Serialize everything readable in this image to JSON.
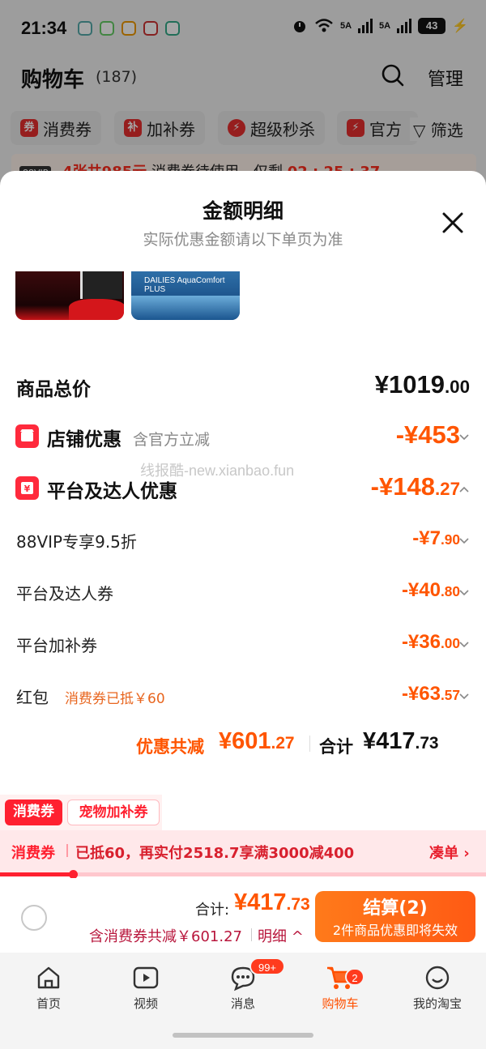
{
  "status_bar": {
    "time": "21:34",
    "signal1": "5A",
    "signal2": "5A",
    "battery": "43"
  },
  "cart": {
    "title": "购物车",
    "count": "(187)",
    "manage": "管理",
    "filters": [
      "消费券",
      "加补券",
      "超级秒杀",
      "官方"
    ],
    "filter_icons": [
      "券",
      "补",
      "⚡",
      "⚡"
    ],
    "filter_btn": "筛选",
    "banner": {
      "vip": "88VIP",
      "highlight": "4张共985元",
      "text": "消费券待使用，仅剩",
      "timer": "02 : 25 : 37"
    }
  },
  "sheet": {
    "title": "金额明细",
    "subtitle": "实际优惠金额请以下单页为准",
    "total_price": {
      "label": "商品总价",
      "int": "¥1019",
      "dec": ".00"
    },
    "store_discount": {
      "label": "店铺优惠",
      "note": "含官方立减",
      "int": "-¥453",
      "dec": ""
    },
    "platform_discount": {
      "label": "平台及达人优惠",
      "int": "-¥148",
      "dec": ".27"
    },
    "details": [
      {
        "label": "88VIP专享9.5折",
        "int": "-¥7",
        "dec": ".90",
        "note": ""
      },
      {
        "label": "平台及达人券",
        "int": "-¥40",
        "dec": ".80",
        "note": ""
      },
      {
        "label": "平台加补券",
        "int": "-¥36",
        "dec": ".00",
        "note": ""
      },
      {
        "label": "红包",
        "int": "-¥63",
        "dec": ".57",
        "note": "消费券已抵￥60"
      }
    ],
    "watermark": "线报酷-new.xianbao.fun",
    "summary": {
      "saved_label": "优惠共减",
      "saved_int": "¥601",
      "saved_dec": ".27",
      "total_label": "合计",
      "total_int": "¥417",
      "total_dec": ".73"
    }
  },
  "coupon": {
    "tags": [
      "消费券",
      "宠物加补券"
    ],
    "bar_label": "消费券",
    "bar_text": "已抵60，再实付2518.7享满3000减400",
    "bar_link": "凑单 ›",
    "progress": 0.15
  },
  "checkout": {
    "total_label": "合计:",
    "total_int": "¥417",
    "total_dec": ".73",
    "saved": "含消费券共减￥601.27",
    "detail_link": "明细 ^",
    "settle_label": "结算(2)",
    "settle_sub": "2件商品优惠即将失效"
  },
  "tabbar": [
    {
      "label": "首页",
      "icon": "home-icon"
    },
    {
      "label": "视频",
      "icon": "video-icon"
    },
    {
      "label": "消息",
      "icon": "message-icon",
      "badge": "99+"
    },
    {
      "label": "购物车",
      "icon": "cart-icon",
      "badge": "2",
      "active": true
    },
    {
      "label": "我的淘宝",
      "icon": "profile-icon"
    }
  ],
  "colors": {
    "accent": "#ff5500",
    "red": "#ff2030",
    "icon_red": "#ff2a3c"
  }
}
